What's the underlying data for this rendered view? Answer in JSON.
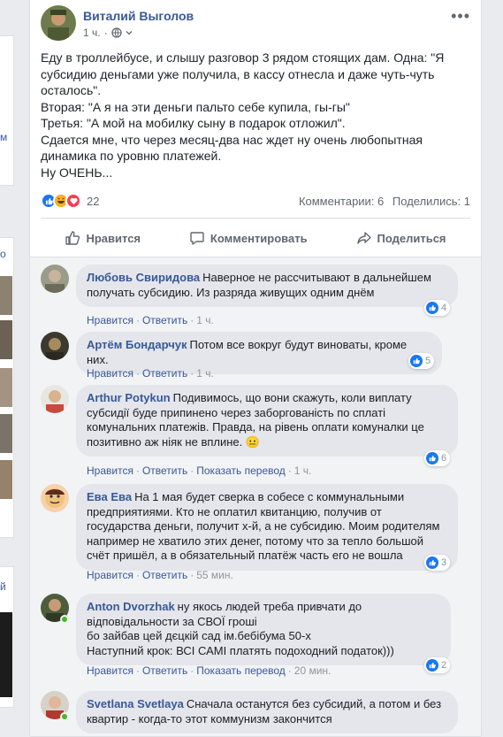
{
  "left": {
    "chars": [
      "м",
      "о",
      "й"
    ]
  },
  "post": {
    "author": "Виталий Выголов",
    "time": "1 ч.",
    "lines": [
      "Еду в троллейбусе, и слышу разговор 3 рядом стоящих дам. Одна: \"Я субсидию деньгами уже получила, в кассу отнесла и даже чуть-чуть осталось\".",
      "Вторая: \"А я на эти деньги пальто себе купила, гы-гы\"",
      "Третья: \"А мой на мобилку сыну в подарок отложил\".",
      "Сдается мне, что через месяц-два нас ждет ну очень любопытная динамика по уровню платежей.",
      "Ну ОЧЕНЬ..."
    ],
    "reactions_count": "22",
    "comments_count": "Комментарии: 6",
    "shares_count": "Поделились: 1",
    "actions": {
      "like": "Нравится",
      "comment": "Комментировать",
      "share": "Поделиться"
    }
  },
  "comment_links": {
    "like": "Нравится",
    "reply": "Ответить",
    "translate": "Показать перевод",
    "sep": "·"
  },
  "comments": [
    {
      "name": "Любовь Свиридова",
      "text": "Наверное не рассчитывают в дальнейшем получать субсидию. Из разряда живущих одним днём",
      "likes": "4",
      "time": "1 ч."
    },
    {
      "name": "Артём Бондарчук",
      "text": "Потом все вокруг будут виноваты, кроме них.",
      "likes": "5",
      "time": "1 ч."
    },
    {
      "name": "Arthur Potykun",
      "text": "Подивимось, що вони скажуть, коли виплату субсидії буде припинено через заборгованість по сплаті комунальних платежів. Правда, на рівень оплати комуналки це позитивно аж ніяк не вплине. 😐",
      "likes": "6",
      "time": "1 ч."
    },
    {
      "name": "Ева Ева",
      "text": "На 1 мая будет сверка в собесе с коммунальными предприятиями. Кто не оплатил квитанцию, получив от государства деньги, получит х-й, а не субсидию. Моим родителям например не хватило этих денег, потому что за тепло большой счёт пришёл, а в обязательный платёж часть его не вошла",
      "likes": "3",
      "time": "55 мин."
    },
    {
      "name": "Anton Dvorzhak",
      "text1": "ну якось людей треба привчати до відповідальности за СВОЇ гроші",
      "text2": "бо зайбав цей дєцкій сад ім.бебібума 50-х",
      "text3": "Наступний крок: ВСІ САМІ платять подоходний податок)))",
      "likes": "2",
      "time": "20 мин."
    },
    {
      "name": "Svetlana Svetlaya",
      "text": "Сначала останутся без субсидий, а потом и без квартир - когда-то этот коммунизм закончится"
    }
  ]
}
